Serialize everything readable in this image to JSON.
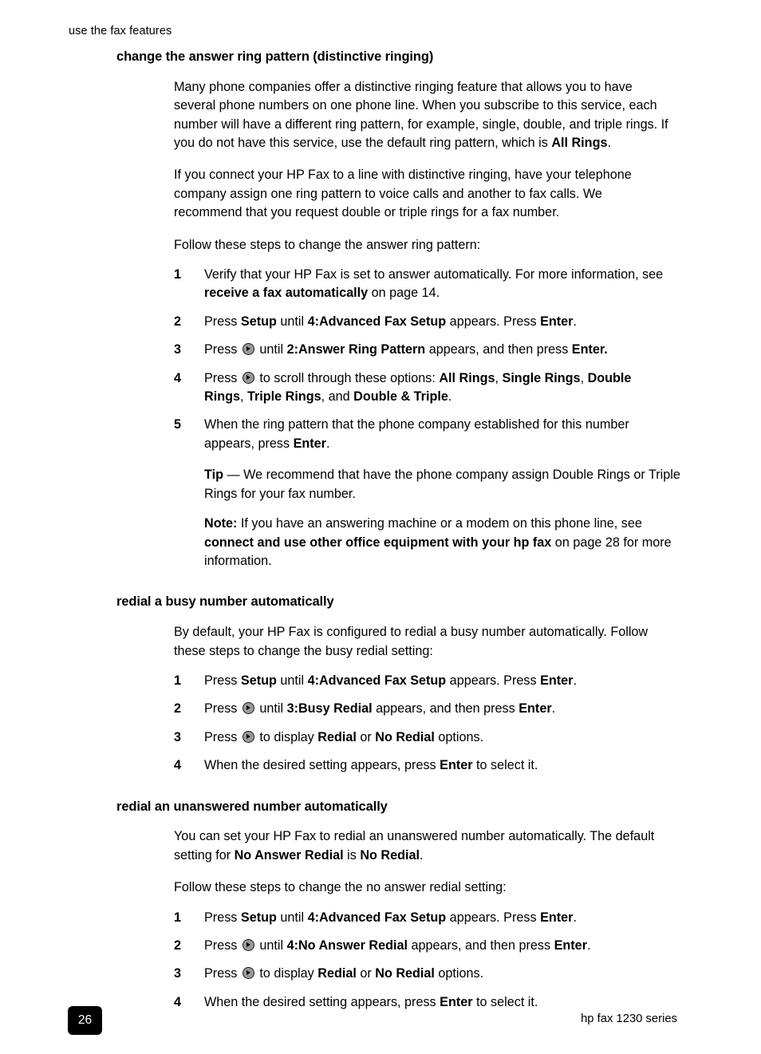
{
  "header": {
    "running_head": "use the fax features"
  },
  "sections": [
    {
      "heading": "change the answer ring pattern (distinctive ringing)",
      "paragraphs": [
        "Many phone companies offer a distinctive ringing feature that allows you to have several phone numbers on one phone line. When you subscribe to this service, each number will have a different ring pattern, for example, single, double, and triple rings. If you do not have this service, use the default ring pattern, which is",
        "If you connect your HP Fax to a line with distinctive ringing, have your telephone company assign one ring pattern to voice calls and another to fax calls. We recommend that you request double or triple rings for a fax number.",
        "Follow these steps to change the answer ring pattern:"
      ],
      "para1_bold_tail": "All Rings",
      "para1_tail_punct": ".",
      "steps": [
        {
          "num": "1",
          "pre": "Verify that your HP Fax is set to answer automatically. For more information, see ",
          "bold1": "receive a fax automatically",
          "mid": " on page 14.",
          "bold2": "",
          "post": ""
        },
        {
          "num": "2",
          "pre": "Press ",
          "bold1": "Setup",
          "mid": " until ",
          "bold2": "4:Advanced Fax Setup",
          "mid2": " appears. Press ",
          "bold3": "Enter",
          "post": "."
        },
        {
          "num": "3",
          "pre": "Press ",
          "icon": "arrow-right-key-icon",
          "mid": " until ",
          "bold2": "2:Answer Ring Pattern",
          "mid2": " appears, and then press ",
          "bold3": "Enter.",
          "post": ""
        },
        {
          "num": "4",
          "pre": "Press ",
          "icon": "arrow-right-key-icon",
          "mid": " to scroll through these options: ",
          "opt1": "All Rings",
          "sep1": ", ",
          "opt2": "Single Rings",
          "sep2": ", ",
          "opt3": "Double Rings",
          "sep3": ", ",
          "opt4": "Triple Rings",
          "sep4": ", and ",
          "opt5": "Double & Triple",
          "post": "."
        },
        {
          "num": "5",
          "pre": "When the ring pattern that the phone company established for this number appears, press ",
          "bold1": "Enter",
          "post": "."
        }
      ],
      "tip": {
        "label": "Tip",
        "dash": " — ",
        "text": "We recommend that have the phone company assign Double Rings or Triple Rings for your fax number."
      },
      "note": {
        "label": "Note:",
        "pre": " If you have an answering machine or a modem on this phone line, see ",
        "bold": "connect and use other office equipment with your hp fax",
        "post": " on page 28 for more information."
      }
    },
    {
      "heading": "redial a busy number automatically",
      "paragraphs": [
        "By default, your HP Fax is configured to redial a busy number automatically. Follow these steps to change the busy redial setting:"
      ],
      "steps": [
        {
          "num": "1",
          "pre": "Press ",
          "bold1": "Setup",
          "mid": " until ",
          "bold2": "4:Advanced Fax Setup",
          "mid2": " appears. Press ",
          "bold3": "Enter",
          "post": "."
        },
        {
          "num": "2",
          "pre": "Press ",
          "icon": "arrow-right-key-icon",
          "mid": " until ",
          "bold2": "3:Busy Redial",
          "mid2": " appears, and then press ",
          "bold3": "Enter",
          "post": "."
        },
        {
          "num": "3",
          "pre": "Press ",
          "icon": "arrow-right-key-icon",
          "mid": " to display ",
          "bold2": "Redial",
          "mid2": " or ",
          "bold3": "No Redial",
          "post": " options."
        },
        {
          "num": "4",
          "pre": "When the desired setting appears, press ",
          "bold1": "Enter",
          "post": " to select it."
        }
      ]
    },
    {
      "heading": "redial an unanswered number automatically",
      "paragraphs": [
        "Follow these steps to change the no answer redial setting:"
      ],
      "intro": {
        "pre": "You can set your HP Fax to redial an unanswered number automatically. The default setting for ",
        "bold1": "No Answer Redial",
        "mid": " is ",
        "bold2": "No Redial",
        "post": "."
      },
      "steps": [
        {
          "num": "1",
          "pre": "Press ",
          "bold1": "Setup",
          "mid": " until ",
          "bold2": "4:Advanced Fax Setup",
          "mid2": " appears. Press ",
          "bold3": "Enter",
          "post": "."
        },
        {
          "num": "2",
          "pre": "Press ",
          "icon": "arrow-right-key-icon",
          "mid": " until ",
          "bold2": "4:No Answer Redial",
          "mid2": " appears, and then press ",
          "bold3": "Enter",
          "post": "."
        },
        {
          "num": "3",
          "pre": "Press ",
          "icon": "arrow-right-key-icon",
          "mid": " to display ",
          "bold2": "Redial",
          "mid2": " or ",
          "bold3": "No Redial",
          "post": " options."
        },
        {
          "num": "4",
          "pre": "When the desired setting appears, press ",
          "bold1": "Enter",
          "post": " to select it."
        }
      ]
    }
  ],
  "footer": {
    "page_number": "26",
    "product": "hp fax 1230 series"
  }
}
